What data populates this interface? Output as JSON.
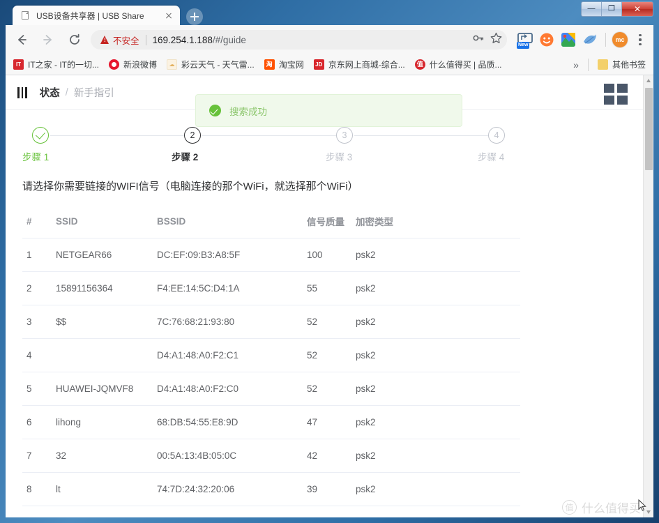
{
  "browser": {
    "tab": {
      "title": "USB设备共享器 | USB Share",
      "favicon": "page-icon",
      "close": "×"
    },
    "newtab_label": "+",
    "window_controls": {
      "minimize": "—",
      "maximize": "❐",
      "close": "✕"
    },
    "toolbar": {
      "back": "back-arrow",
      "forward": "forward-arrow",
      "reload": "reload-arrow",
      "security_label": "不安全",
      "url_host": "169.254.1.188",
      "url_path": "/#/guide",
      "key_icon": "password-key-icon",
      "star_icon": "bookmark-star-icon",
      "extensions": [
        {
          "name": "screencast-new-extension",
          "badge": "New"
        },
        {
          "name": "smiley-extension",
          "glyph": "☺"
        },
        {
          "name": "photos-extension",
          "glyph": ""
        },
        {
          "name": "bird-extension",
          "glyph": ""
        }
      ],
      "avatar_initials": "mc",
      "menu": "three-dot-menu"
    },
    "bookmarks": [
      {
        "label": "IT之家 - IT的一切...",
        "icon_text": "IT",
        "icon_color": "#d7282f"
      },
      {
        "label": "新浪微博",
        "icon_text": "",
        "icon_color": "#e6162d"
      },
      {
        "label": "彩云天气 - 天气雷...",
        "icon_text": "",
        "icon_color": "#f5e9d0"
      },
      {
        "label": "淘宝网",
        "icon_text": "淘",
        "icon_color": "#ff5000"
      },
      {
        "label": "京东网上商城-综合...",
        "icon_text": "JD",
        "icon_color": "#d8262c"
      },
      {
        "label": "什么值得买 | 品质...",
        "icon_text": "值",
        "icon_color": "#d7282f"
      }
    ],
    "bookmarks_overflow": "»",
    "other_bookmarks": {
      "label": "其他书签",
      "icon_color": "#f3d06b"
    }
  },
  "page": {
    "header": {
      "collapse_icon": "collapse-menu-icon",
      "breadcrumb_current": "状态",
      "breadcrumb_separator": "/",
      "breadcrumb_sub": "新手指引",
      "grid_icon": "grid-view-icon"
    },
    "toast": {
      "message": "搜索成功",
      "icon": "success-check-icon",
      "type": "success"
    },
    "steps": [
      {
        "index": "1",
        "label": "步骤 1",
        "state": "done"
      },
      {
        "index": "2",
        "label": "步骤 2",
        "state": "active"
      },
      {
        "index": "3",
        "label": "步骤 3",
        "state": "pending"
      },
      {
        "index": "4",
        "label": "步骤 4",
        "state": "pending"
      }
    ],
    "instruction": "请选择你需要链接的WIFI信号（电脑连接的那个WiFi，就选择那个WiFi）",
    "table": {
      "headers": [
        "#",
        "SSID",
        "BSSID",
        "信号质量",
        "加密类型"
      ],
      "rows": [
        {
          "idx": "1",
          "ssid": "NETGEAR66",
          "bssid": "DC:EF:09:B3:A8:5F",
          "signal": "100",
          "enc": "psk2"
        },
        {
          "idx": "2",
          "ssid": "15891156364",
          "bssid": "F4:EE:14:5C:D4:1A",
          "signal": "55",
          "enc": "psk2"
        },
        {
          "idx": "3",
          "ssid": "$$",
          "bssid": "7C:76:68:21:93:80",
          "signal": "52",
          "enc": "psk2"
        },
        {
          "idx": "4",
          "ssid": "",
          "bssid": "D4:A1:48:A0:F2:C1",
          "signal": "52",
          "enc": "psk2"
        },
        {
          "idx": "5",
          "ssid": "HUAWEI-JQMVF8",
          "bssid": "D4:A1:48:A0:F2:C0",
          "signal": "52",
          "enc": "psk2"
        },
        {
          "idx": "6",
          "ssid": "lihong",
          "bssid": "68:DB:54:55:E8:9D",
          "signal": "47",
          "enc": "psk2"
        },
        {
          "idx": "7",
          "ssid": "32",
          "bssid": "00:5A:13:4B:05:0C",
          "signal": "42",
          "enc": "psk2"
        },
        {
          "idx": "8",
          "ssid": "lt",
          "bssid": "74:7D:24:32:20:06",
          "signal": "39",
          "enc": "psk2"
        }
      ]
    },
    "watermark": {
      "logo": "值",
      "text": "什么值得买"
    }
  },
  "colors": {
    "success": "#67c23a",
    "toast_bg": "#f0f9eb",
    "danger": "#c5221f",
    "text_primary": "#303133",
    "text_regular": "#606266",
    "text_secondary": "#909399",
    "text_placeholder": "#c0c4cc",
    "border": "#ebeef5"
  }
}
